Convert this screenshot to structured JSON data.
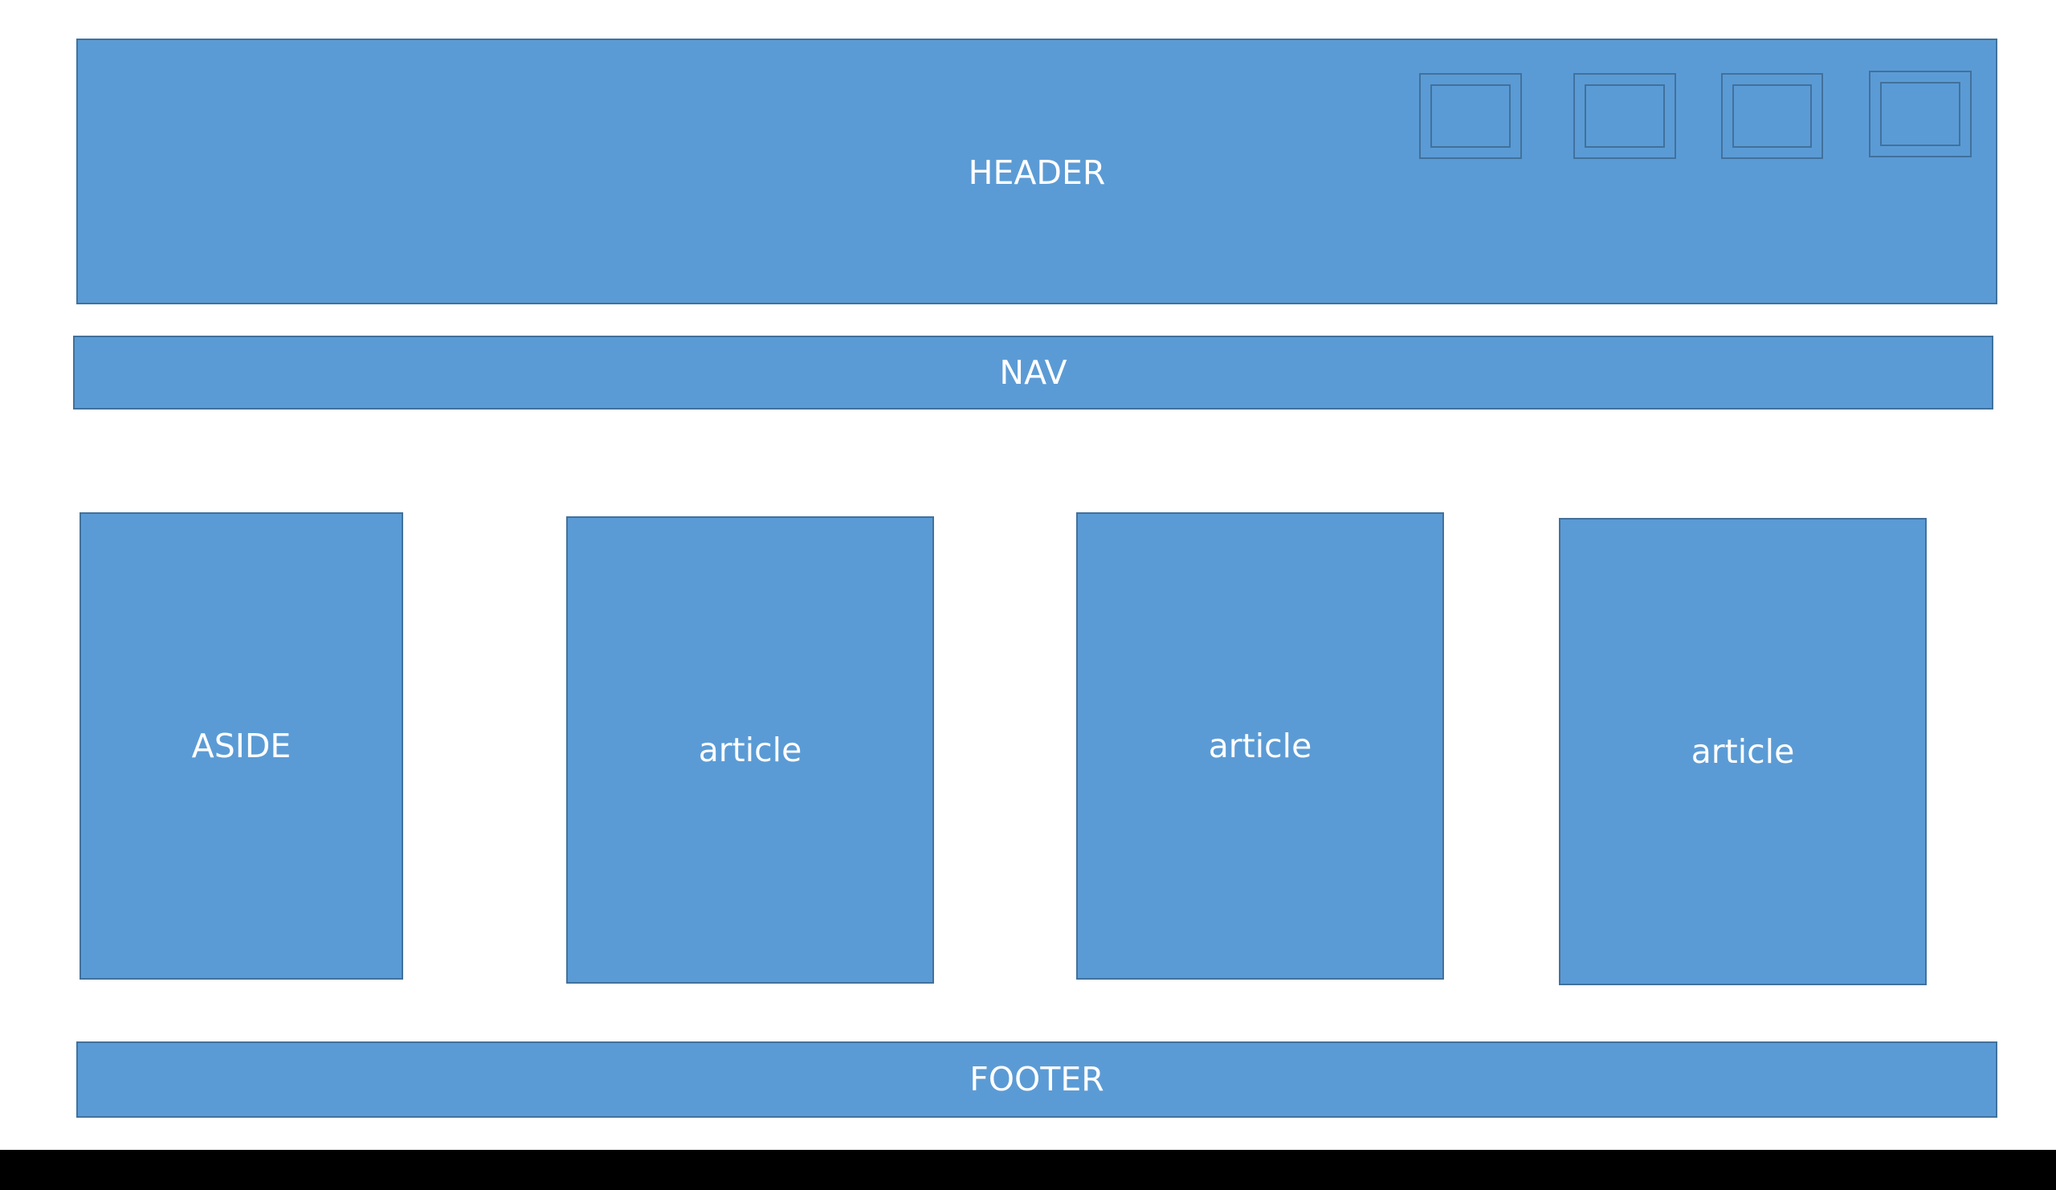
{
  "header": {
    "label": "HEADER",
    "icons": [
      "window-icon",
      "window-icon",
      "window-icon",
      "window-icon"
    ]
  },
  "nav": {
    "label": "NAV"
  },
  "aside": {
    "label": "ASIDE"
  },
  "articles": [
    {
      "label": "article"
    },
    {
      "label": "article"
    },
    {
      "label": "article"
    }
  ],
  "footer": {
    "label": "FOOTER"
  },
  "colors": {
    "fill": "#5b9bd5",
    "border": "#41719c",
    "text": "#ffffff",
    "background": "#ffffff"
  }
}
